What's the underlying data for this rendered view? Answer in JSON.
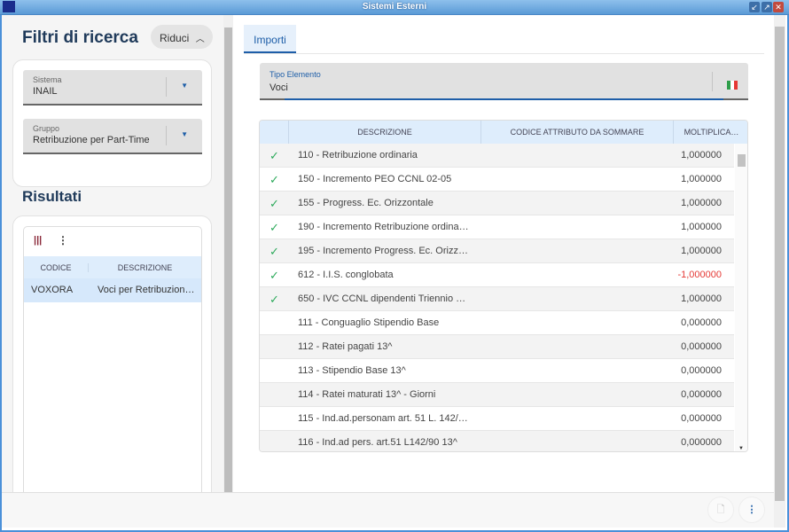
{
  "window": {
    "title": "Sistemi Esterni"
  },
  "filters": {
    "title": "Filtri di ricerca",
    "collapse_label": "Riduci",
    "sistema": {
      "label": "Sistema",
      "value": "INAIL"
    },
    "gruppo": {
      "label": "Gruppo",
      "value": "Retribuzione per Part-Time"
    }
  },
  "results": {
    "title": "Risultati",
    "columns": [
      "CODICE",
      "DESCRIZIONE"
    ],
    "rows": [
      {
        "codice": "VOXORA",
        "descrizione": "Voci per Retribuzion…"
      }
    ]
  },
  "tabs": [
    {
      "label": "Importi"
    }
  ],
  "tipo_elemento": {
    "label": "Tipo Elemento",
    "value": "Voci"
  },
  "table": {
    "columns": [
      "DESCRIZIONE",
      "CODICE ATTRIBUTO DA SOMMARE",
      "MOLTIPLICA…"
    ],
    "rows": [
      {
        "check": "✓",
        "descrizione": "110 - Retribuzione ordinaria",
        "molt": "1,000000"
      },
      {
        "check": "✓",
        "descrizione": "150 - Incremento PEO CCNL 02-05",
        "molt": "1,000000"
      },
      {
        "check": "✓",
        "descrizione": "155 - Progress. Ec. Orizzontale",
        "molt": "1,000000"
      },
      {
        "check": "✓",
        "descrizione": "190 - Incremento Retribuzione ordinar…",
        "molt": "1,000000"
      },
      {
        "check": "✓",
        "descrizione": "195 - Incremento Progress. Ec. Orizzo…",
        "molt": "1,000000"
      },
      {
        "check": "✓",
        "descrizione": "612 - I.I.S. conglobata",
        "molt": "-1,000000"
      },
      {
        "check": "✓",
        "descrizione": "650 - IVC CCNL dipendenti Triennio 2…",
        "molt": "1,000000"
      },
      {
        "check": "",
        "descrizione": "111 - Conguaglio Stipendio Base",
        "molt": "0,000000"
      },
      {
        "check": "",
        "descrizione": "112 - Ratei pagati 13^",
        "molt": "0,000000"
      },
      {
        "check": "",
        "descrizione": "113 - Stipendio Base 13^",
        "molt": "0,000000"
      },
      {
        "check": "",
        "descrizione": "114 - Ratei maturati 13^ - Giorni",
        "molt": "0,000000"
      },
      {
        "check": "",
        "descrizione": "115 - Ind.ad.personam art. 51 L. 142/…",
        "molt": "0,000000"
      },
      {
        "check": "",
        "descrizione": "116 - Ind.ad pers. art.51 L142/90 13^",
        "molt": "0,000000"
      }
    ]
  }
}
